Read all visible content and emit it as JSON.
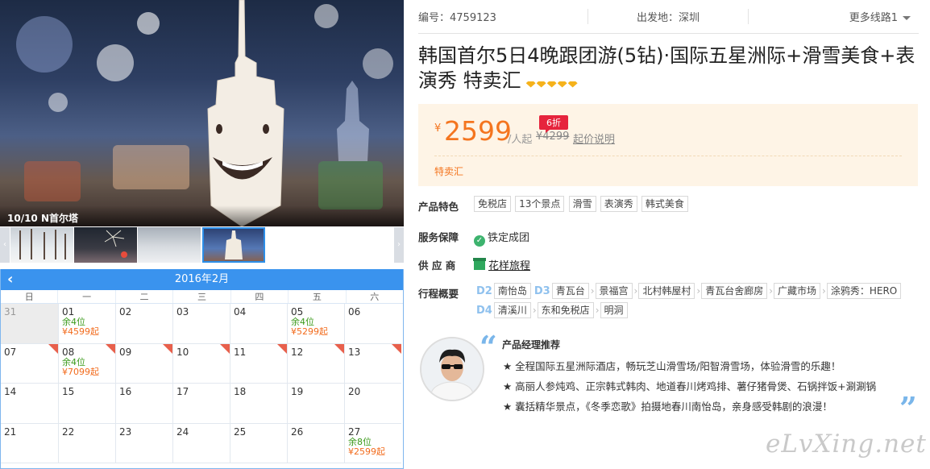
{
  "gallery": {
    "caption": "10/10 N首尔塔",
    "prev_arrow": "‹",
    "next_arrow": "›",
    "thumbnails": [
      "snow-forest",
      "fireworks",
      "snowy-slope",
      "n-seoul-tower"
    ],
    "active_index": 3
  },
  "calendar": {
    "prev": "‹",
    "month": "2016年2月",
    "weekdays": [
      "日",
      "一",
      "二",
      "三",
      "四",
      "五",
      "六"
    ],
    "cells": [
      {
        "day": "31",
        "muted": true,
        "rem": "",
        "price": "",
        "corner": false
      },
      {
        "day": "01",
        "muted": false,
        "rem": "余4位",
        "price": "¥4599起",
        "corner": false
      },
      {
        "day": "02",
        "muted": false,
        "rem": "",
        "price": "",
        "corner": false
      },
      {
        "day": "03",
        "muted": false,
        "rem": "",
        "price": "",
        "corner": false
      },
      {
        "day": "04",
        "muted": false,
        "rem": "",
        "price": "",
        "corner": false
      },
      {
        "day": "05",
        "muted": false,
        "rem": "余4位",
        "price": "¥5299起",
        "corner": false
      },
      {
        "day": "06",
        "muted": false,
        "rem": "",
        "price": "",
        "corner": false
      },
      {
        "day": "07",
        "muted": false,
        "rem": "",
        "price": "",
        "corner": true
      },
      {
        "day": "08",
        "muted": false,
        "rem": "余4位",
        "price": "¥7099起",
        "corner": true
      },
      {
        "day": "09",
        "muted": false,
        "rem": "",
        "price": "",
        "corner": true
      },
      {
        "day": "10",
        "muted": false,
        "rem": "",
        "price": "",
        "corner": true
      },
      {
        "day": "11",
        "muted": false,
        "rem": "",
        "price": "",
        "corner": true
      },
      {
        "day": "12",
        "muted": false,
        "rem": "",
        "price": "",
        "corner": true
      },
      {
        "day": "13",
        "muted": false,
        "rem": "",
        "price": "",
        "corner": true
      },
      {
        "day": "14",
        "muted": false,
        "rem": "",
        "price": "",
        "corner": false
      },
      {
        "day": "15",
        "muted": false,
        "rem": "",
        "price": "",
        "corner": false
      },
      {
        "day": "16",
        "muted": false,
        "rem": "",
        "price": "",
        "corner": false
      },
      {
        "day": "17",
        "muted": false,
        "rem": "",
        "price": "",
        "corner": false
      },
      {
        "day": "18",
        "muted": false,
        "rem": "",
        "price": "",
        "corner": false
      },
      {
        "day": "19",
        "muted": false,
        "rem": "",
        "price": "",
        "corner": false
      },
      {
        "day": "20",
        "muted": false,
        "rem": "",
        "price": "",
        "corner": false
      },
      {
        "day": "21",
        "muted": false,
        "rem": "",
        "price": "",
        "corner": false
      },
      {
        "day": "22",
        "muted": false,
        "rem": "",
        "price": "",
        "corner": false
      },
      {
        "day": "23",
        "muted": false,
        "rem": "",
        "price": "",
        "corner": false
      },
      {
        "day": "24",
        "muted": false,
        "rem": "",
        "price": "",
        "corner": false
      },
      {
        "day": "25",
        "muted": false,
        "rem": "",
        "price": "",
        "corner": false
      },
      {
        "day": "26",
        "muted": false,
        "rem": "",
        "price": "",
        "corner": false
      },
      {
        "day": "27",
        "muted": false,
        "rem": "余8位",
        "price": "¥2599起",
        "corner": false
      }
    ]
  },
  "meta": {
    "code": "编号：4759123",
    "departure": "出发地：深圳",
    "more_routes": "更多线路1"
  },
  "product": {
    "title": "韩国首尔5日4晚跟团游(5钻)·国际五星洲际+滑雪美食+表演秀",
    "title_tag": " 特卖汇",
    "diamonds": 5
  },
  "pricing": {
    "currency": "¥",
    "price": "2599",
    "per_person": "/人起",
    "original": "¥4299",
    "discount": "6折",
    "note": "起价说明",
    "promo": "特卖汇"
  },
  "features": {
    "label": "产品特色",
    "items": [
      "免税店",
      "13个景点",
      "滑雪",
      "表演秀",
      "韩式美食"
    ]
  },
  "guarantee": {
    "label": "服务保障",
    "text": "铁定成团"
  },
  "supplier": {
    "label": "供 应 商",
    "name": "花样旅程"
  },
  "itinerary": {
    "label": "行程概要",
    "segments": [
      {
        "day": "D2",
        "stops": [
          "南怡岛"
        ]
      },
      {
        "day": "D3",
        "stops": [
          "青瓦台",
          "景福宫",
          "北村韩屋村",
          "青瓦台舍廊房",
          "广藏市场",
          "涂鸦秀：HERO"
        ]
      },
      {
        "day": "D4",
        "stops": [
          "清溪川",
          "东和免税店",
          "明洞"
        ]
      }
    ],
    "separator": "›"
  },
  "recommend": {
    "title": "产品经理推荐",
    "lines": [
      "★ 全程国际五星洲际酒店，畅玩芝山滑雪场/阳智滑雪场，体验滑雪的乐趣！",
      "★ 高丽人参炖鸡、正宗韩式韩肉、地道春川烤鸡排、薯仔猪骨煲、石锅拌饭+涮涮锅",
      "★ 囊括精华景点，《冬季恋歌》拍摄地春川南怡岛，亲身感受韩剧的浪漫！"
    ],
    "open_quote": "“",
    "close_quote": "”"
  },
  "watermark": "eLvXing.net",
  "colors": {
    "accent_blue": "#3a93ee",
    "price_orange": "#f4751f",
    "discount_red": "#e6243d",
    "remain_green": "#3a9a1a"
  }
}
